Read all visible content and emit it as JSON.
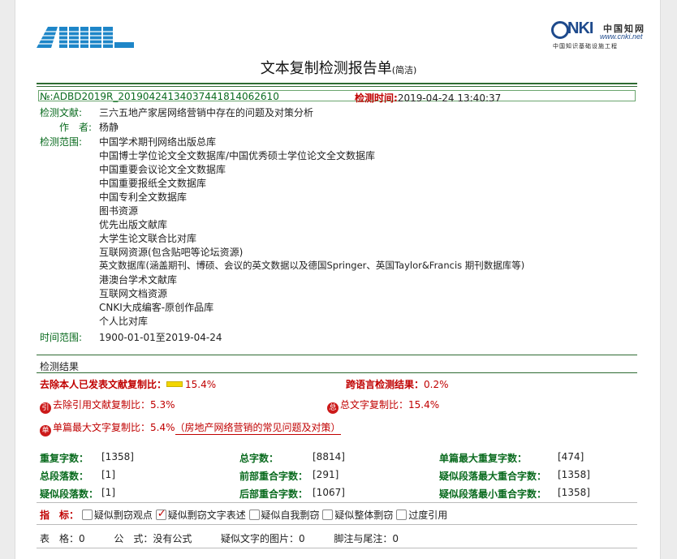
{
  "header": {
    "logo_left_icon": "amnc-logo-icon",
    "logo_right": {
      "nki": "NKI",
      "cn": "中国知网",
      "url": "www.cnki.net",
      "project": "中国知识基础设施工程"
    },
    "title": "文本复制检测报告单",
    "title_suffix": "(简洁)"
  },
  "meta": {
    "report_no": "№:ADBD2019R_20190424134037441814062610",
    "check_time_label": "检测时间:",
    "check_time": "2019-04-24 13:40:37",
    "doc_label": "检测文献:",
    "doc_title": "三六五地产家居网络营销中存在的问题及对策分析",
    "author_label": "作　者:",
    "author": "杨静",
    "scope_label": "检测范围:",
    "scope": [
      "中国学术期刊网络出版总库",
      "中国博士学位论文全文数据库/中国优秀硕士学位论文全文数据库",
      "中国重要会议论文全文数据库",
      "中国重要报纸全文数据库",
      "中国专利全文数据库",
      "图书资源",
      "优先出版文献库",
      "大学生论文联合比对库",
      "互联网资源(包含贴吧等论坛资源)",
      "英文数据库(涵盖期刊、博硕、会议的英文数据以及德国Springer、英国Taylor&Francis 期刊数据库等)",
      "港澳台学术文献库",
      "互联网文档资源",
      "CNKI大成编客-原创作品库",
      "个人比对库"
    ],
    "range_label": "时间范围:",
    "range": "1900-01-01至2019-04-24"
  },
  "results": {
    "section_title": "检测结果",
    "excl_self_label": "去除本人已发表文献复制比：",
    "excl_self_value": "15.4%",
    "cross_lang_label": "跨语言检测结果：",
    "cross_lang_value": "0.2%",
    "excl_cite_badge": "引",
    "excl_cite_label": "去除引用文献复制比：",
    "excl_cite_value": "5.3%",
    "total_badge": "总",
    "total_label": "总文字复制比：",
    "total_value": "15.4%",
    "single_badge": "单",
    "single_label": "单篇最大文字复制比：",
    "single_value": "5.4%",
    "single_source": "（房地产网络营销的常见问题及对策）",
    "stats": [
      [
        {
          "label": "重复字数：",
          "value": "[1358]"
        },
        {
          "label": "总字数：",
          "value": "[8814]"
        },
        {
          "label": "单篇最大重复字数：",
          "value": "[474]"
        }
      ],
      [
        {
          "label": "总段落数：",
          "value": "[1]"
        },
        {
          "label": "前部重合字数：",
          "value": "[291]"
        },
        {
          "label": "疑似段落最大重合字数：",
          "value": "[1358]"
        }
      ],
      [
        {
          "label": "疑似段落数：",
          "value": "[1]"
        },
        {
          "label": "后部重合字数：",
          "value": "[1067]"
        },
        {
          "label": "疑似段落最小重合字数：",
          "value": "[1358]"
        }
      ]
    ],
    "indicator_label": "指　标：",
    "indicators": [
      {
        "label": "疑似剽窃观点",
        "checked": false
      },
      {
        "label": "疑似剽窃文字表述",
        "checked": true
      },
      {
        "label": "疑似自我剽窃",
        "checked": false
      },
      {
        "label": "疑似整体剽窃",
        "checked": false
      },
      {
        "label": "过度引用",
        "checked": false
      }
    ],
    "footer_items": [
      {
        "label": "表　格：",
        "value": "0"
      },
      {
        "label": "公　式：",
        "value": "没有公式"
      },
      {
        "label": "疑似文字的图片：",
        "value": "0"
      },
      {
        "label": "脚注与尾注：",
        "value": "0"
      }
    ]
  },
  "colors": {
    "rule_green": "#2e6b32",
    "label_green": "#0a6b1f",
    "accent_red": "#c00000",
    "bar_yellow": "#f2d600"
  }
}
